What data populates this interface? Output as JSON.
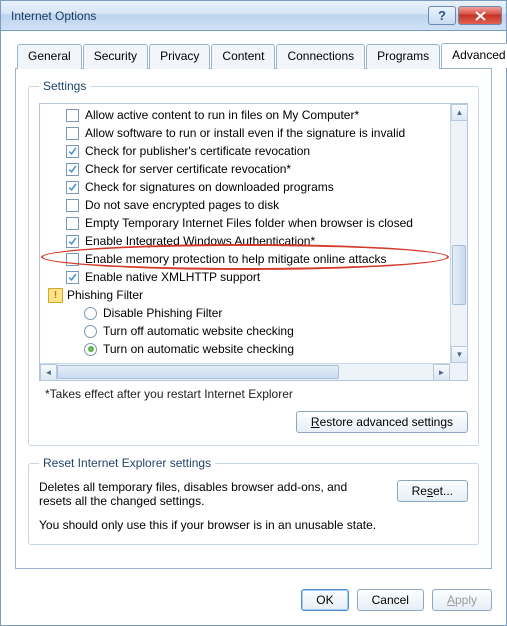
{
  "window": {
    "title": "Internet Options"
  },
  "tabs": [
    "General",
    "Security",
    "Privacy",
    "Content",
    "Connections",
    "Programs",
    "Advanced"
  ],
  "active_tab": 6,
  "settings": {
    "legend": "Settings",
    "items": [
      {
        "t": "cb",
        "c": false,
        "label": "Allow active content to run in files on My Computer*"
      },
      {
        "t": "cb",
        "c": false,
        "label": "Allow software to run or install even if the signature is invalid"
      },
      {
        "t": "cb",
        "c": true,
        "label": "Check for publisher's certificate revocation"
      },
      {
        "t": "cb",
        "c": true,
        "label": "Check for server certificate revocation*"
      },
      {
        "t": "cb",
        "c": true,
        "label": "Check for signatures on downloaded programs"
      },
      {
        "t": "cb",
        "c": false,
        "label": "Do not save encrypted pages to disk"
      },
      {
        "t": "cb",
        "c": false,
        "label": "Empty Temporary Internet Files folder when browser is closed"
      },
      {
        "t": "cb",
        "c": true,
        "label": "Enable Integrated Windows Authentication*"
      },
      {
        "t": "cb",
        "c": false,
        "label": "Enable memory protection to help mitigate online attacks"
      },
      {
        "t": "cb",
        "c": true,
        "label": "Enable native XMLHTTP support"
      },
      {
        "t": "grp",
        "label": "Phishing Filter"
      },
      {
        "t": "rb",
        "c": false,
        "label": "Disable Phishing Filter"
      },
      {
        "t": "rb",
        "c": false,
        "label": "Turn off automatic website checking"
      },
      {
        "t": "rb",
        "c": true,
        "label": "Turn on automatic website checking"
      }
    ],
    "note": "*Takes effect after you restart Internet Explorer",
    "restore": "Restore advanced settings"
  },
  "reset": {
    "legend": "Reset Internet Explorer settings",
    "text": "Deletes all temporary files, disables browser add-ons, and resets all the changed settings.",
    "btn": "Reset...",
    "warn": "You should only use this if your browser is in an unusable state."
  },
  "footer": {
    "ok": "OK",
    "cancel": "Cancel",
    "apply": "Apply"
  },
  "highlight": {
    "item_index": 8
  }
}
